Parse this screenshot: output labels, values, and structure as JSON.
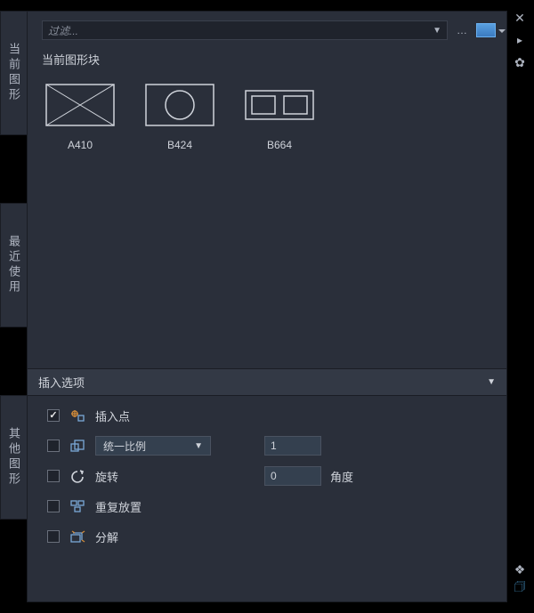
{
  "filter": {
    "placeholder": "过滤..."
  },
  "tabs": {
    "current": "当前图形",
    "recent": "最近使用",
    "other": "其他图形"
  },
  "section": {
    "current_blocks": "当前图形块"
  },
  "blocks": [
    {
      "name": "A410"
    },
    {
      "name": "B424"
    },
    {
      "name": "B664"
    }
  ],
  "options": {
    "header": "插入选项",
    "insertion_point": "插入点",
    "uniform_scale_label": "统一比例",
    "scale_value": "1",
    "rotate_label": "旋转",
    "rotate_value": "0",
    "angle_label": "角度",
    "repeat_label": "重复放置",
    "explode_label": "分解"
  }
}
